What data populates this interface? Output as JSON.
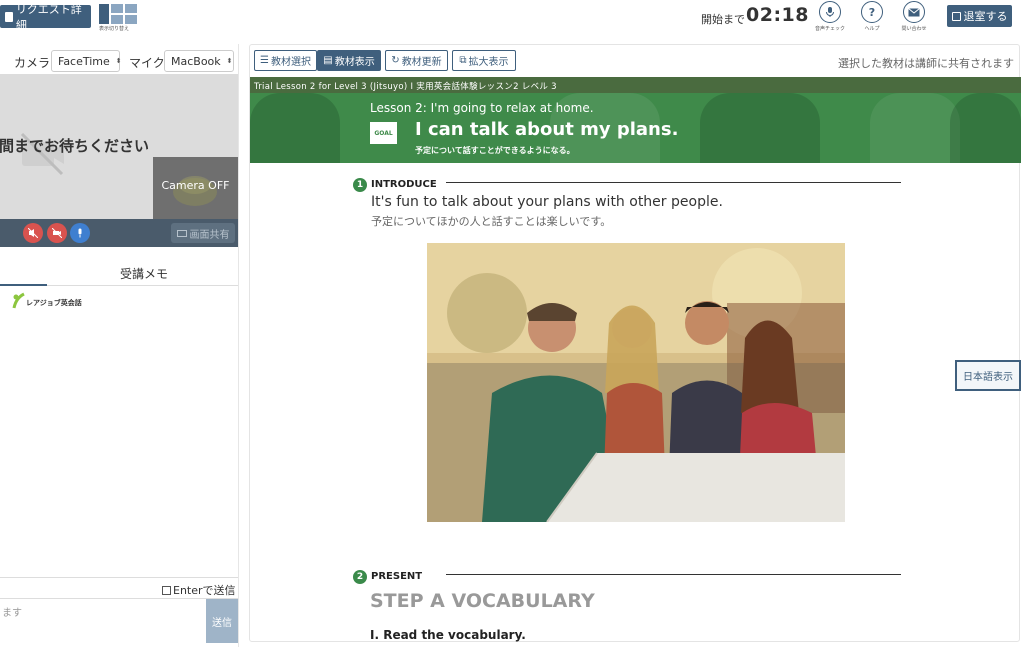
{
  "header": {
    "request_button": "リクエスト詳細",
    "layout_switch_caption": "表示切り替え",
    "start_label": "開始まで",
    "timer": "02:18",
    "icons": [
      {
        "name": "mic-check-icon",
        "label": "音声チェック"
      },
      {
        "name": "help-icon",
        "label": "ヘルプ"
      },
      {
        "name": "mail-icon",
        "label": "問い合わせ"
      }
    ],
    "leave_button": "退室する"
  },
  "left": {
    "camera_label": "カメラ",
    "camera_value": "FaceTime",
    "mic_label": "マイク",
    "mic_value": "MacBook",
    "wait_text": "間までお待ちください",
    "camera_off": "Camera OFF",
    "screen_share": "画面共有",
    "memo_tab": "受講メモ",
    "logo_text": "レアジョブ英会話",
    "enter_send": "Enterで送信",
    "chat_placeholder": "ます",
    "send_button": "送信",
    "control_colors": {
      "mute": "#d9534f",
      "video": "#d9534f",
      "mic": "#3f7fd0"
    }
  },
  "toolbar": {
    "select_material": "教材選択",
    "show_material": "教材表示",
    "refresh_material": "教材更新",
    "enlarge": "拡大表示",
    "share_note": "選択した教材は講師に共有されます"
  },
  "material": {
    "strip": "Trial Lesson 2 for Level 3 (Jitsuyo) I 実用英会話体験レッスン2 レベル 3",
    "lesson_title": "Lesson 2: I'm going to relax at home.",
    "goal_badge": "GOAL",
    "goal_text": "I can talk about my plans.",
    "goal_sub": "予定について話すことができるようになる。",
    "section1_num": "1",
    "section1_title": "INTRODUCE",
    "intro_en": "It's fun to talk about your plans with other people.",
    "intro_ja": "予定についてほかの人と話すことは楽しいです。",
    "section2_num": "2",
    "section2_title": "PRESENT",
    "step_title": "STEP A VOCABULARY",
    "read_vocab": "I. Read the vocabulary.",
    "jp_toggle": "日本語表示"
  },
  "colors": {
    "accent": "#3f5f7d",
    "green": "#3f8a4a"
  }
}
